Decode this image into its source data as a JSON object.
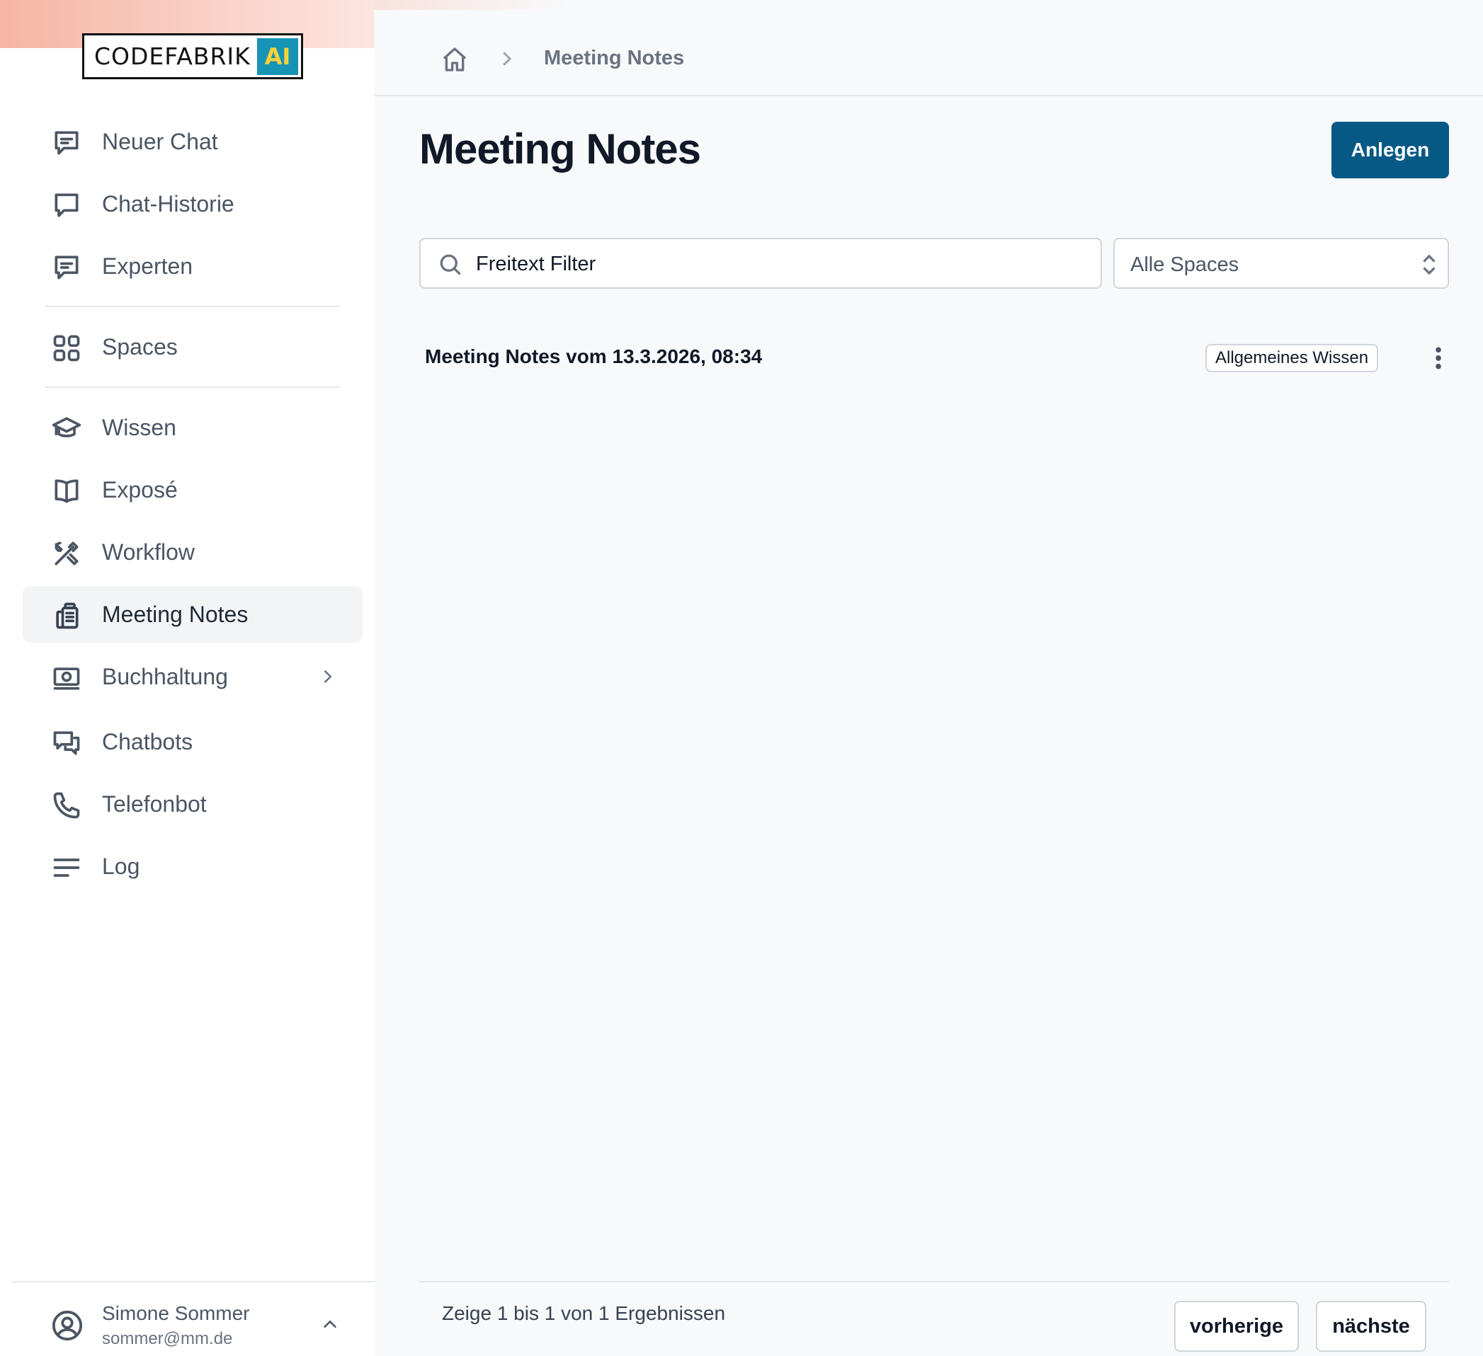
{
  "brand": {
    "logo_text": "CODEFABRIK",
    "logo_badge": "AI"
  },
  "sidebar": {
    "items": [
      {
        "label": "Neuer Chat",
        "icon": "chat-bubble-lines-icon"
      },
      {
        "label": "Chat-Historie",
        "icon": "chat-bubble-icon"
      },
      {
        "label": "Experten",
        "icon": "chat-bubble-lines-icon"
      },
      {
        "label": "Spaces",
        "icon": "grid-icon"
      },
      {
        "label": "Wissen",
        "icon": "academic-cap-icon"
      },
      {
        "label": "Exposé",
        "icon": "book-open-icon"
      },
      {
        "label": "Workflow",
        "icon": "wrench-screwdriver-icon"
      },
      {
        "label": "Meeting Notes",
        "icon": "clipboard-document-icon",
        "active": true
      },
      {
        "label": "Buchhaltung",
        "icon": "banknotes-icon",
        "expandable": true
      },
      {
        "label": "Chatbots",
        "icon": "chat-bubbles-icon"
      },
      {
        "label": "Telefonbot",
        "icon": "phone-icon"
      },
      {
        "label": "Log",
        "icon": "bars-icon"
      }
    ]
  },
  "user": {
    "name": "Simone Sommer",
    "email": "sommer@mm.de"
  },
  "breadcrumb": {
    "current": "Meeting Notes"
  },
  "page": {
    "title": "Meeting Notes",
    "create_label": "Anlegen"
  },
  "filters": {
    "search_placeholder": "Freitext Filter",
    "space_select_value": "Alle Spaces"
  },
  "notes": [
    {
      "title": "Meeting Notes vom 13.3.2026, 08:34",
      "space": "Allgemeines Wissen"
    }
  ],
  "pagination": {
    "summary": "Zeige 1 bis 1 von 1 Ergebnissen",
    "prev_label": "vorherige",
    "next_label": "nächste"
  },
  "colors": {
    "primary": "#075985",
    "logo_badge_bg": "#1793b5",
    "logo_badge_text": "#f5d13b"
  }
}
